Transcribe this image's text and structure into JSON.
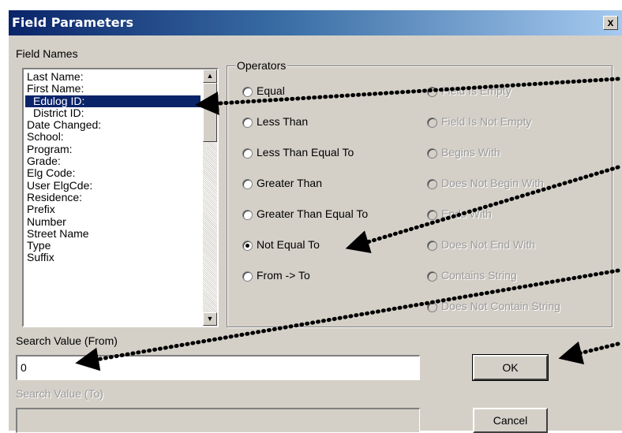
{
  "dialog": {
    "title": "Field Parameters",
    "close_label": "x"
  },
  "field_names": {
    "label": "Field Names",
    "items": [
      {
        "text": "Last Name:",
        "selected": false,
        "indent": false
      },
      {
        "text": "First Name:",
        "selected": false,
        "indent": false
      },
      {
        "text": "Edulog ID:",
        "selected": true,
        "indent": true
      },
      {
        "text": "District ID:",
        "selected": false,
        "indent": true
      },
      {
        "text": "Date Changed:",
        "selected": false,
        "indent": false
      },
      {
        "text": "School:",
        "selected": false,
        "indent": false
      },
      {
        "text": "Program:",
        "selected": false,
        "indent": false
      },
      {
        "text": "Grade:",
        "selected": false,
        "indent": false
      },
      {
        "text": "Elg Code:",
        "selected": false,
        "indent": false
      },
      {
        "text": "User ElgCde:",
        "selected": false,
        "indent": false
      },
      {
        "text": "Residence:",
        "selected": false,
        "indent": false
      },
      {
        "text": "Prefix",
        "selected": false,
        "indent": false
      },
      {
        "text": "Number",
        "selected": false,
        "indent": false
      },
      {
        "text": "Street Name",
        "selected": false,
        "indent": false
      },
      {
        "text": "Type",
        "selected": false,
        "indent": false
      },
      {
        "text": "Suffix",
        "selected": false,
        "indent": false
      }
    ]
  },
  "operators": {
    "label": "Operators",
    "left": [
      {
        "text": "Equal",
        "checked": false,
        "enabled": true
      },
      {
        "text": "Less Than",
        "checked": false,
        "enabled": true
      },
      {
        "text": "Less Than Equal To",
        "checked": false,
        "enabled": true
      },
      {
        "text": "Greater Than",
        "checked": false,
        "enabled": true
      },
      {
        "text": "Greater Than Equal To",
        "checked": false,
        "enabled": true
      },
      {
        "text": "Not Equal To",
        "checked": true,
        "enabled": true
      },
      {
        "text": "From -> To",
        "checked": false,
        "enabled": true
      }
    ],
    "right": [
      {
        "text": "Field Is Empty",
        "checked": false,
        "enabled": false
      },
      {
        "text": "Field Is Not Empty",
        "checked": false,
        "enabled": false
      },
      {
        "text": "Begins With",
        "checked": false,
        "enabled": false
      },
      {
        "text": "Does Not Begin With",
        "checked": false,
        "enabled": false
      },
      {
        "text": "Ends With",
        "checked": false,
        "enabled": false
      },
      {
        "text": "Does Not End With",
        "checked": false,
        "enabled": false
      },
      {
        "text": "Contains String",
        "checked": false,
        "enabled": false
      },
      {
        "text": "Does Not Contain String",
        "checked": false,
        "enabled": false
      }
    ]
  },
  "search_from": {
    "label": "Search Value (From)",
    "value": "0"
  },
  "search_to": {
    "label": "Search Value (To)",
    "value": ""
  },
  "buttons": {
    "ok": "OK",
    "cancel": "Cancel"
  },
  "colors": {
    "selection": "#0a246a",
    "dialog_bg": "#d4d0c8",
    "title_start": "#0a246a",
    "title_end": "#a6caf0"
  }
}
